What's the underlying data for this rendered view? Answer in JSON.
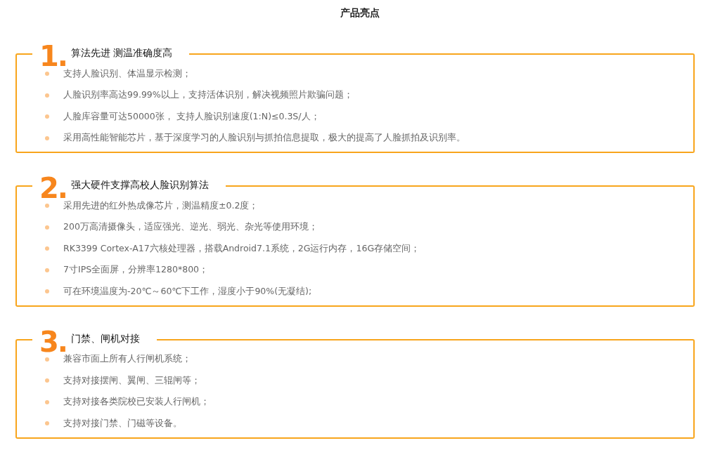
{
  "title": "产品亮点",
  "sections": [
    {
      "number": "1.",
      "heading": "算法先进 测温准确度高",
      "items": [
        "支持人脸识别、体温显示检测；",
        "人脸识别率高达99.99%以上，支持活体识别，解决视频照片欺骗问题；",
        "人脸库容量可达50000张， 支持人脸识别速度(1:N)≤0.3S/人；",
        "采用高性能智能芯片，基于深度学习的人脸识别与抓拍信息提取，极大的提高了人脸抓拍及识别率。"
      ]
    },
    {
      "number": "2.",
      "heading": "强大硬件支撑高校人脸识别算法",
      "items": [
        "采用先进的红外热成像芯片，测温精度±0.2度；",
        "200万高清摄像头，适应强光、逆光、弱光、杂光等使用环境；",
        "RK3399 Cortex-A17六核处理器，搭载Android7.1系统，2G运行内存，16G存储空间；",
        "7寸IPS全面屏，分辨率1280*800；",
        "可在环境温度为-20℃～60℃下工作，湿度小于90%(无凝结);"
      ]
    },
    {
      "number": "3.",
      "heading": "门禁、闸机对接",
      "items": [
        "兼容市面上所有人行闸机系统；",
        "支持对接摆闸、翼闸、三辊闸等；",
        "支持对接各类院校已安装人行闸机；",
        "支持对接门禁、门磁等设备。"
      ]
    }
  ]
}
